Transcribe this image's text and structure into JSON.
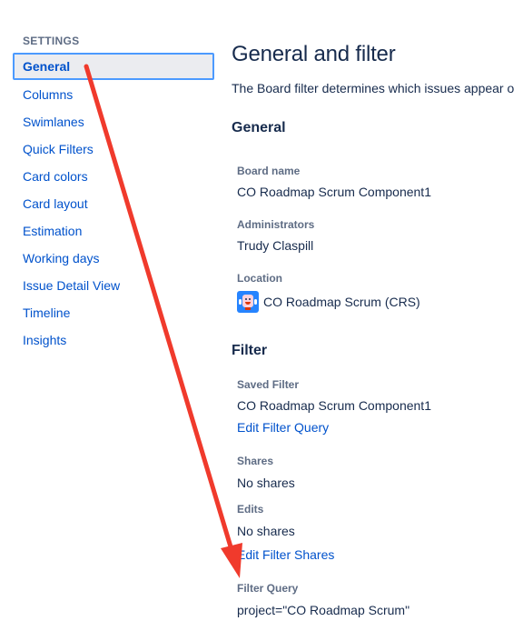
{
  "sidebar": {
    "heading": "SETTINGS",
    "items": [
      {
        "label": "General",
        "active": true
      },
      {
        "label": "Columns"
      },
      {
        "label": "Swimlanes"
      },
      {
        "label": "Quick Filters"
      },
      {
        "label": "Card colors"
      },
      {
        "label": "Card layout"
      },
      {
        "label": "Estimation"
      },
      {
        "label": "Working days"
      },
      {
        "label": "Issue Detail View"
      },
      {
        "label": "Timeline"
      },
      {
        "label": "Insights"
      }
    ]
  },
  "main": {
    "title": "General and filter",
    "description": "The Board filter determines which issues appear o",
    "general": {
      "title": "General",
      "board_name_label": "Board name",
      "board_name_value": "CO Roadmap Scrum Component1",
      "administrators_label": "Administrators",
      "administrators_value": "Trudy Claspill",
      "location_label": "Location",
      "location_value": "CO Roadmap Scrum (CRS)",
      "location_icon": "project-avatar-icon"
    },
    "filter": {
      "title": "Filter",
      "saved_filter_label": "Saved Filter",
      "saved_filter_value": "CO Roadmap Scrum Component1",
      "edit_filter_query_link": "Edit Filter Query",
      "shares_label": "Shares",
      "shares_value": "No shares",
      "edits_label": "Edits",
      "edits_value": "No shares",
      "edit_filter_shares_link": "Edit Filter Shares",
      "filter_query_label": "Filter Query",
      "filter_query_value": "project=\"CO Roadmap Scrum\""
    }
  },
  "colors": {
    "link": "#0052cc",
    "text": "#172b4d",
    "subtle": "#5e6c84",
    "active_bg": "#ebecf0",
    "focus_border": "#4c9aff",
    "annotation_arrow": "#f03a2c"
  }
}
